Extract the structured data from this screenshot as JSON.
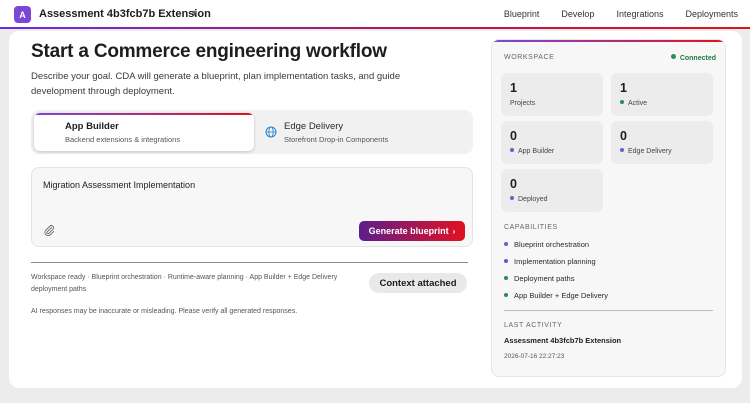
{
  "topbar": {
    "badge": "A",
    "title": "Assessment 4b3fcb7b Extension",
    "caret": "▼",
    "nav": [
      "Blueprint",
      "Develop",
      "Integrations",
      "Deployments"
    ]
  },
  "main": {
    "headline": "Start a Commerce engineering workflow",
    "subtext": "Describe your goal. CDA will generate a blueprint, plan implementation tasks, and guide development through deployment.",
    "options": [
      {
        "title": "App Builder",
        "subtitle": "Backend extensions & integrations",
        "selected": true
      },
      {
        "title": "Edge Delivery",
        "subtitle": "Storefront Drop-in Components",
        "selected": false
      }
    ],
    "prompt_value": "Migration Assessment Implementation",
    "generate_label": "Generate blueprint",
    "generate_chevron": "›",
    "status_line": "Workspace ready · Blueprint orchestration · Runtime-aware planning · App Builder + Edge Delivery deployment paths",
    "context_label": "Context attached",
    "disclaimer": "AI responses may be inaccurate or misleading. Please verify all generated responses."
  },
  "workspace": {
    "label": "WORKSPACE",
    "status": "Connected",
    "status_color": "#2e8b57",
    "stats": [
      {
        "value": "1",
        "label": "Projects",
        "dot": ""
      },
      {
        "value": "1",
        "label": "Active",
        "dot": "#2e8b57"
      },
      {
        "value": "0",
        "label": "App Builder",
        "dot": "#5a67c8"
      },
      {
        "value": "0",
        "label": "Edge Delivery",
        "dot": "#5a67c8"
      },
      {
        "value": "0",
        "label": "Deployed",
        "dot": "#5a67c8"
      }
    ],
    "capabilities_label": "CAPABILITIES",
    "capabilities": [
      {
        "label": "Blueprint orchestration",
        "color": "#5a67c8"
      },
      {
        "label": "Implementation planning",
        "color": "#7b48d6"
      },
      {
        "label": "Deployment paths",
        "color": "#2e8b57"
      },
      {
        "label": "App Builder + Edge Delivery",
        "color": "#2e8b57"
      }
    ],
    "last_activity_label": "LAST ACTIVITY",
    "last_activity_title": "Assessment 4b3fcb7b Extension",
    "last_activity_time": "2026-07-16 22:27:23"
  }
}
